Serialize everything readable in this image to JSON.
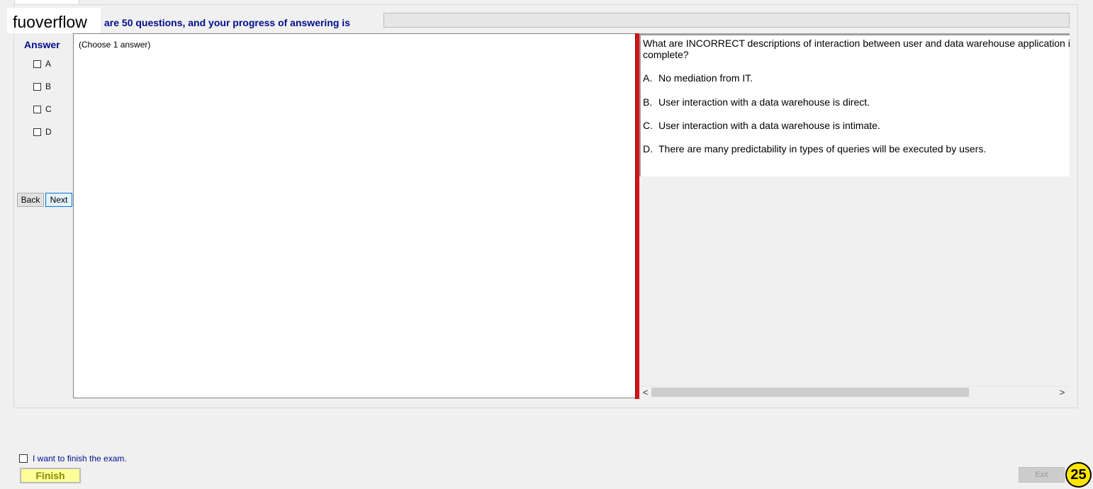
{
  "watermark": "fuoverflow",
  "header": {
    "progress_label": "are 50 questions, and your progress of answering is",
    "progress_value": 0
  },
  "answer_panel": {
    "title": "Answer",
    "choices": [
      "A",
      "B",
      "C",
      "D"
    ],
    "hint": "(Choose 1 answer)"
  },
  "nav": {
    "back_label": "Back",
    "next_label": "Next"
  },
  "question": {
    "text": "What are INCORRECT descriptions of interaction between user and data warehouse application is implementation complete?",
    "options": [
      {
        "key": "A.",
        "text": "No mediation from IT."
      },
      {
        "key": "B.",
        "text": "User interaction with a data warehouse is direct."
      },
      {
        "key": "C.",
        "text": "User interaction with a data warehouse is intimate."
      },
      {
        "key": "D.",
        "text": "There are many predictability in types of queries will be executed by users."
      }
    ]
  },
  "scrollbar": {
    "left_arrow": "<",
    "right_arrow": ">"
  },
  "footer": {
    "finish_check_label": "I want to finish the exam.",
    "finish_label": "Finish",
    "exit_label": "Exit",
    "page_number": "25"
  }
}
